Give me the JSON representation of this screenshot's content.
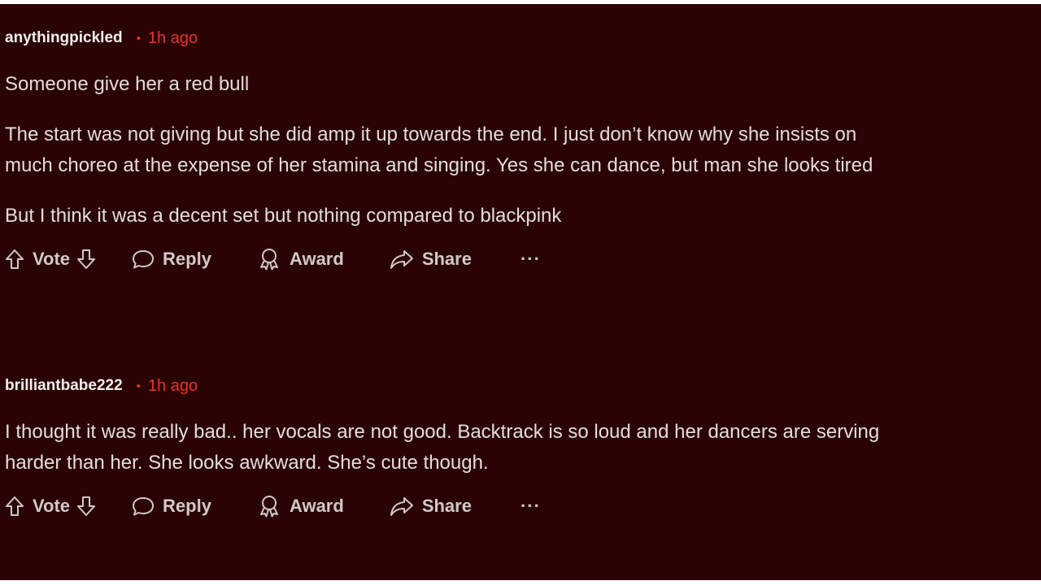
{
  "comments": [
    {
      "author": "anythingpickled",
      "separator": "•",
      "time": "1h ago",
      "paragraphs": [
        "Someone give her a red bull",
        "The start was not giving but she did amp it up towards the end. I just don’t know why she insists on",
        "much choreo at the expense of her stamina and singing. Yes she can dance, but man she looks tired",
        "But I think it was a decent set but nothing compared to blackpink"
      ],
      "actions": {
        "vote_label": "Vote",
        "reply_label": "Reply",
        "award_label": "Award",
        "share_label": "Share",
        "more_label": "···"
      }
    },
    {
      "author": "brilliantbabe222",
      "separator": "•",
      "time": "1h ago",
      "paragraphs": [
        "I thought it was really bad.. her vocals are not good. Backtrack is so loud and her dancers are serving",
        "harder than her. She looks awkward. She’s cute though."
      ],
      "actions": {
        "vote_label": "Vote",
        "reply_label": "Reply",
        "award_label": "Award",
        "share_label": "Share",
        "more_label": "···"
      }
    }
  ],
  "colors": {
    "background": "#2a0404",
    "accent": "#e8332b",
    "text": "#e4dcdc"
  },
  "icons": [
    "upvote-icon",
    "downvote-icon",
    "reply-bubble-icon",
    "award-icon",
    "share-icon",
    "more-icon"
  ]
}
